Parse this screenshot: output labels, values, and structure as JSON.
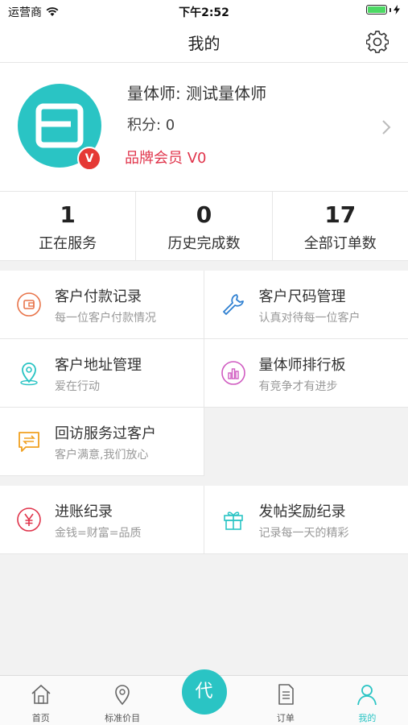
{
  "status": {
    "carrier": "运营商",
    "time": "下午2:52"
  },
  "nav": {
    "title": "我的"
  },
  "profile": {
    "name": "量体师: 测试量体师",
    "points": "积分: 0",
    "member": "品牌会员 V0",
    "vip_badge": "V"
  },
  "stats": [
    {
      "value": "1",
      "label": "正在服务"
    },
    {
      "value": "0",
      "label": "历史完成数"
    },
    {
      "value": "17",
      "label": "全部订单数"
    }
  ],
  "menu": [
    {
      "title": "客户付款记录",
      "sub": "每一位客户付款情况",
      "icon": "wallet-icon",
      "color": "#e8744a"
    },
    {
      "title": "客户尺码管理",
      "sub": "认真对待每一位客户",
      "icon": "wrench-icon",
      "color": "#2f80d1"
    },
    {
      "title": "客户地址管理",
      "sub": "爱在行动",
      "icon": "location-pin-icon",
      "color": "#2ac4c4"
    },
    {
      "title": "量体师排行板",
      "sub": "有竞争才有进步",
      "icon": "chart-icon",
      "color": "#d05bc1"
    },
    {
      "title": "回访服务过客户",
      "sub": "客户满意,我们放心",
      "icon": "chat-transfer-icon",
      "color": "#f0a020"
    }
  ],
  "menu2": [
    {
      "title": "进账纪录",
      "sub": "金钱=财富=品质",
      "icon": "yen-icon",
      "color": "#e0344b"
    },
    {
      "title": "发帖奖励纪录",
      "sub": "记录每一天的精彩",
      "icon": "gift-icon",
      "color": "#2ac4c4"
    }
  ],
  "tabs": [
    {
      "label": "首页",
      "icon": "home-icon"
    },
    {
      "label": "标准价目",
      "icon": "location-pin-icon"
    },
    {
      "label": "代",
      "icon": "center-action"
    },
    {
      "label": "订单",
      "icon": "document-icon"
    },
    {
      "label": "我的",
      "icon": "user-icon"
    }
  ],
  "colors": {
    "accent": "#2ac4c4",
    "brand_red": "#e0344b"
  }
}
